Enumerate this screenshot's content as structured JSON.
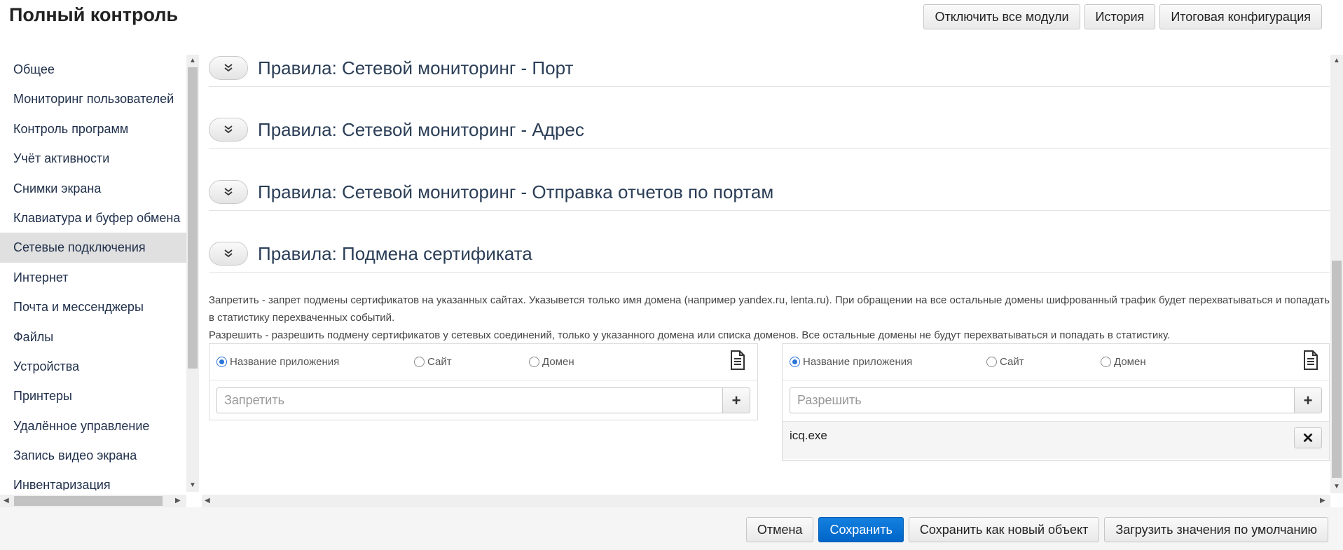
{
  "header": {
    "title": "Полный контроль",
    "buttons": [
      "Отключить все модули",
      "История",
      "Итоговая конфигурация"
    ]
  },
  "sidebar": {
    "items": [
      {
        "label": "Общее"
      },
      {
        "label": "Мониторинг пользователей"
      },
      {
        "label": "Контроль программ"
      },
      {
        "label": "Учёт активности"
      },
      {
        "label": "Снимки экрана"
      },
      {
        "label": "Клавиатура и буфер обмена"
      },
      {
        "label": "Сетевые подключения",
        "active": true
      },
      {
        "label": "Интернет"
      },
      {
        "label": "Почта и мессенджеры"
      },
      {
        "label": "Файлы"
      },
      {
        "label": "Устройства"
      },
      {
        "label": "Принтеры"
      },
      {
        "label": "Удалённое управление"
      },
      {
        "label": "Запись видео экрана"
      },
      {
        "label": "Инвентаризация"
      }
    ]
  },
  "sections": [
    {
      "title": "Правила: Сетевой мониторинг - Порт"
    },
    {
      "title": "Правила: Сетевой мониторинг - Адрес"
    },
    {
      "title": "Правила: Сетевой мониторинг - Отправка отчетов по портам"
    },
    {
      "title": "Правила: Подмена сертификата"
    }
  ],
  "description": {
    "line1": "Запретить - запрет подмены сертификатов на указанных сайтах. Указывется только имя домена (например yandex.ru, lenta.ru). При обращении на все остальные домены шифрованный трафик будет перехватываться и попадать в статистику перехваченных событий.",
    "line2": "Разрешить - разрешить подмену сертификатов у сетевых соединений, только у указанного домена или списка доменов. Все остальные домены не будут перехватываться и попадать в статистику."
  },
  "panels": {
    "deny": {
      "radio_options": [
        "Название приложения",
        "Сайт",
        "Домен"
      ],
      "selected": 0,
      "placeholder": "Запретить",
      "items": []
    },
    "allow": {
      "radio_options": [
        "Название приложения",
        "Сайт",
        "Домен"
      ],
      "selected": 0,
      "placeholder": "Разрешить",
      "items": [
        "icq.exe"
      ]
    }
  },
  "footer": {
    "buttons": [
      "Отмена",
      "Сохранить",
      "Сохранить как новый объект",
      "Загрузить значения по умолчанию"
    ],
    "primary_index": 1
  },
  "icons": {
    "toggle": "double-chevron-down-icon",
    "import": "document-icon",
    "add": "plus-icon",
    "remove": "close-icon"
  },
  "colors": {
    "accent": "#0a6fd6",
    "active_sidebar": "#e0e0e0",
    "section_title": "#2b3e57"
  }
}
